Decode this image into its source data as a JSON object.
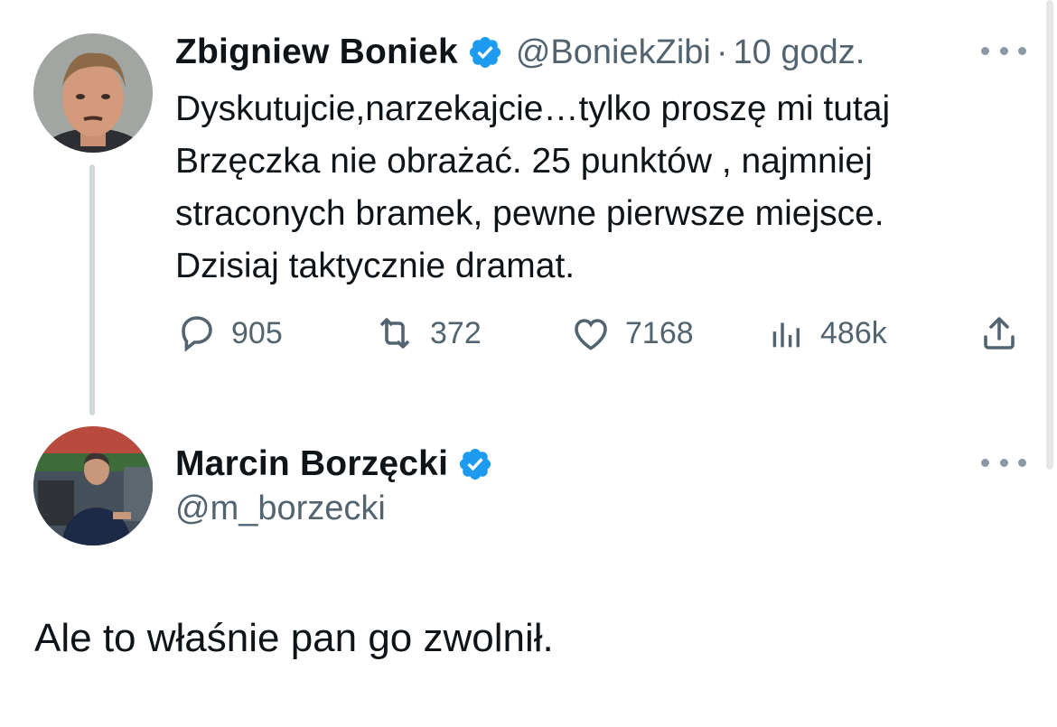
{
  "original_tweet": {
    "author_name": "Zbigniew Boniek",
    "handle": "@BoniekZibi",
    "separator": "·",
    "time": "10 godz.",
    "verified": true,
    "lines": [
      "Dyskutujcie,narzekajcie…tylko proszę mi tutaj",
      "Brzęczka nie obrażać. 25 punktów , najmniej",
      "straconych bramek, pewne pierwsze miejsce.",
      "Dzisiaj taktycznie dramat."
    ],
    "stats": {
      "replies": "905",
      "retweets": "372",
      "likes": "7168",
      "views": "486k"
    },
    "icons": {
      "reply": "reply-icon",
      "retweet": "retweet-icon",
      "like": "heart-icon",
      "views": "views-icon",
      "share": "share-icon",
      "more": "more-icon"
    }
  },
  "reply_tweet": {
    "author_name": "Marcin Borzęcki",
    "handle": "@m_borzecki",
    "verified": true,
    "text": "Ale to właśnie pan go zwolnił."
  },
  "colors": {
    "verified_blue": "#1d9bf0",
    "secondary_text": "#536471",
    "thread_line": "#cfd9de"
  }
}
